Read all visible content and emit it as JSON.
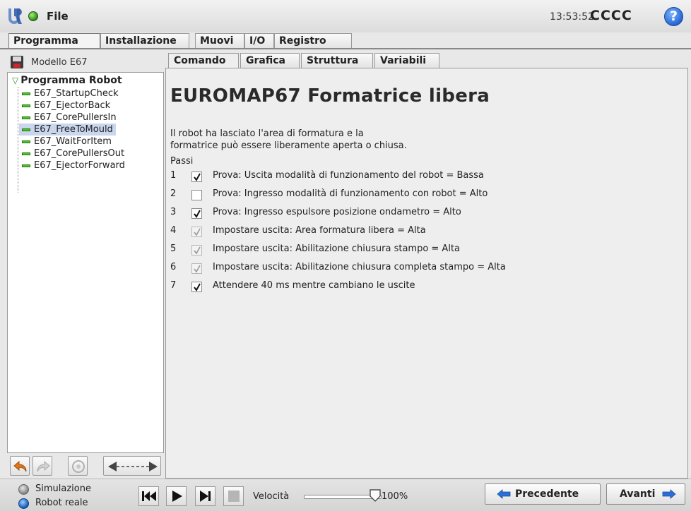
{
  "header": {
    "menu_label": "File",
    "clock": "13:53:52",
    "robot_name": "CCCC",
    "help_label": "?"
  },
  "main_tabs": [
    "Programma",
    "Installazione",
    "Muovi",
    "I/O",
    "Registro"
  ],
  "sidebar": {
    "model_label": "Modello E67",
    "tree_root": "Programma Robot",
    "tree_items": [
      "E67_StartupCheck",
      "E67_EjectorBack",
      "E67_CorePullersIn",
      "E67_FreeToMould",
      "E67_WaitForItem",
      "E67_CorePullersOut",
      "E67_EjectorForward"
    ],
    "selected_item": "E67_FreeToMould"
  },
  "sub_tabs": [
    "Comando",
    "Grafica",
    "Struttura",
    "Variabili"
  ],
  "command": {
    "title": "EUROMAP67 Formatrice libera",
    "description_line1": "Il robot ha lasciato l'area di formatura e la",
    "description_line2": "formatrice può essere liberamente aperta o chiusa.",
    "steps_label": "Passi",
    "steps": [
      {
        "num": "1",
        "text": "Prova: Uscita modalità di funzionamento del robot = Bassa",
        "checked": true,
        "enabled": true
      },
      {
        "num": "2",
        "text": "Prova: Ingresso modalità di funzionamento con robot = Alto",
        "checked": false,
        "enabled": true
      },
      {
        "num": "3",
        "text": "Prova: Ingresso espulsore posizione ondametro = Alto",
        "checked": true,
        "enabled": true
      },
      {
        "num": "4",
        "text": "Impostare uscita: Area formatura libera = Alta",
        "checked": true,
        "enabled": false
      },
      {
        "num": "5",
        "text": "Impostare uscita: Abilitazione chiusura stampo = Alta",
        "checked": true,
        "enabled": false
      },
      {
        "num": "6",
        "text": "Impostare uscita: Abilitazione chiusura completa stampo = Alta",
        "checked": true,
        "enabled": false
      },
      {
        "num": "7",
        "text": "Attendere 40 ms mentre cambiano le uscite",
        "checked": true,
        "enabled": true
      }
    ]
  },
  "footer": {
    "simulation_label": "Simulazione",
    "real_robot_label": "Robot reale",
    "speed_label": "Velocità",
    "speed_value": "100%",
    "prev_label": "Precedente",
    "next_label": "Avanti"
  },
  "colors": {
    "accent_blue": "#1f5fd0",
    "status_green": "#2d8a1a",
    "selection": "#c9d6ee",
    "arrow_orange": "#e0781a"
  }
}
